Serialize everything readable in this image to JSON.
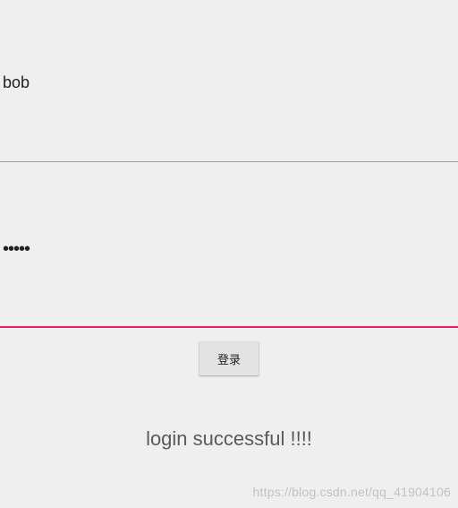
{
  "username": {
    "value": "bob"
  },
  "password": {
    "value": "•••••"
  },
  "login_button": {
    "label": "登录"
  },
  "status": {
    "message": "login successful !!!!"
  },
  "watermark": {
    "text": "https://blog.csdn.net/qq_41904106"
  }
}
